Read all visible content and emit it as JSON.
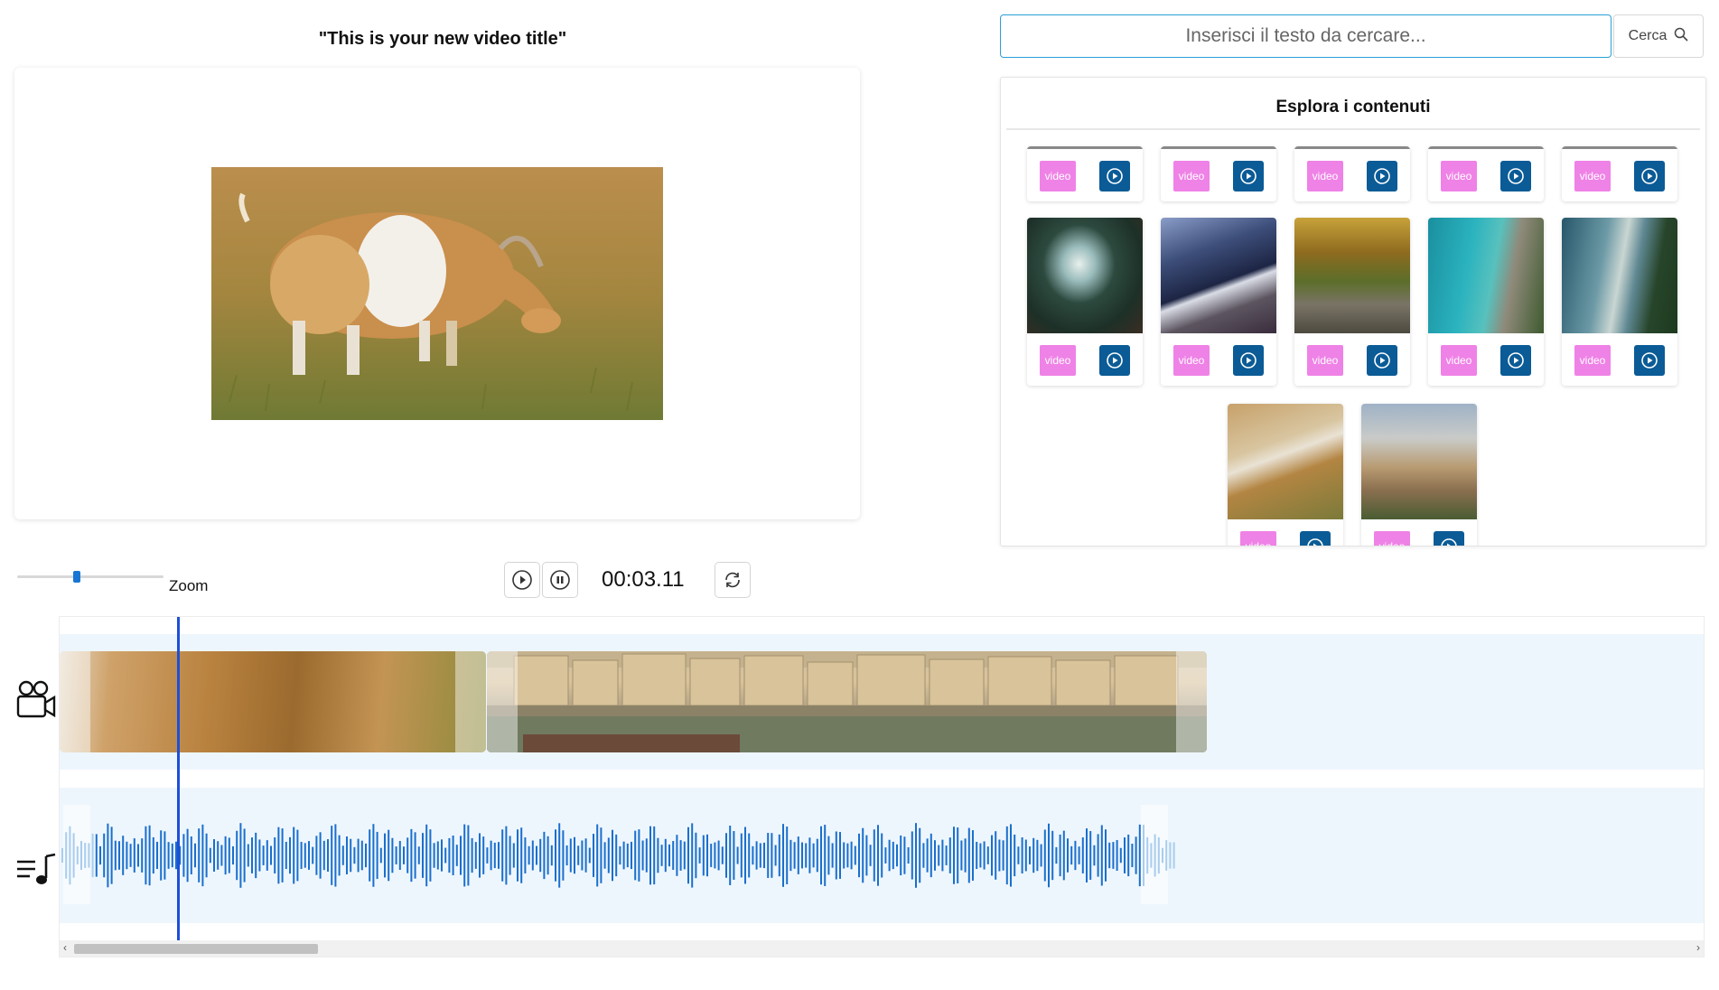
{
  "preview": {
    "title": "\"This is your new video title\""
  },
  "search": {
    "placeholder": "Inserisci il testo da cercare...",
    "button_label": "Cerca"
  },
  "content_panel": {
    "title": "Esplora i contenuti",
    "badge_label": "video"
  },
  "controls": {
    "zoom_label": "Zoom",
    "zoom_level": 0.45,
    "time": "00:03.11"
  },
  "timeline": {
    "scroll_position": 0.0
  },
  "icons": {
    "search": "search-icon",
    "play": "play-icon",
    "pause": "pause-icon",
    "loop": "loop-icon",
    "video_track": "video-camera-icon",
    "audio_track": "music-playlist-icon"
  },
  "colors": {
    "accent": "#1e4fd8",
    "badge": "#ef82e6",
    "play_button": "#0b5b96",
    "track_background": "#eef6fd",
    "waveform": "#1a6fcc"
  }
}
